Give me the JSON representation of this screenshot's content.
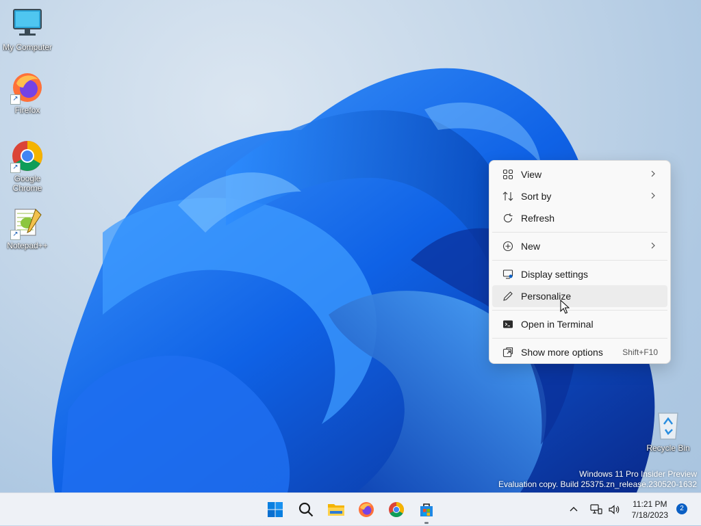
{
  "desktop": {
    "icons": [
      {
        "label": "My Computer"
      },
      {
        "label": "Firefox"
      },
      {
        "label": "Google Chrome"
      },
      {
        "label": "Notepad++"
      },
      {
        "label": "Recycle Bin"
      }
    ]
  },
  "context_menu": {
    "items": [
      {
        "label": "View",
        "icon": "view-grid-icon",
        "submenu": true
      },
      {
        "label": "Sort by",
        "icon": "sort-icon",
        "submenu": true
      },
      {
        "label": "Refresh",
        "icon": "refresh-icon"
      },
      {
        "label": "New",
        "icon": "new-plus-icon",
        "submenu": true
      },
      {
        "label": "Display settings",
        "icon": "display-settings-icon"
      },
      {
        "label": "Personalize",
        "icon": "pen-icon",
        "highlighted": true
      },
      {
        "label": "Open in Terminal",
        "icon": "terminal-icon"
      },
      {
        "label": "Show more options",
        "icon": "show-more-icon",
        "shortcut": "Shift+F10"
      }
    ]
  },
  "watermark": {
    "line1": "Windows 11 Pro Insider Preview",
    "line2": "Evaluation copy. Build 25375.zn_release.230520-1632"
  },
  "taskbar": {
    "apps": [
      "start-icon",
      "search-icon",
      "file-explorer-icon",
      "firefox-icon",
      "chrome-icon",
      "store-icon"
    ],
    "time": "11:21 PM",
    "date": "7/18/2023",
    "notification_count": "2"
  },
  "colors": {
    "accent": "#0a5fc4",
    "taskbar": "#eef1f6",
    "menu_bg": "#f9f9f9"
  }
}
